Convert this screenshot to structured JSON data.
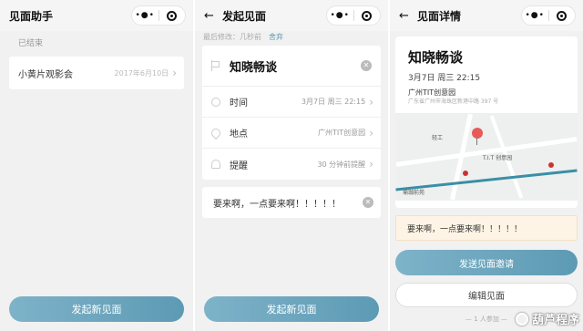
{
  "panel1": {
    "nav_title": "见面助手",
    "section_label": "已结束",
    "items": [
      {
        "title": "小黄片观影会",
        "date": "2017年6月10日"
      }
    ],
    "primary_button": "发起新见面"
  },
  "panel2": {
    "nav_title": "发起见面",
    "last_modified": "最后修改：几秒前",
    "discard": "舍弃",
    "event_title": "知晓畅谈",
    "fields": [
      {
        "label": "时间",
        "value": "3月7日   周三   22:15"
      },
      {
        "label": "地点",
        "value": "广州TIT创意园"
      },
      {
        "label": "提醒",
        "value": "30 分钟前提醒"
      }
    ],
    "note": "要来啊，一点要来啊！！！！！",
    "primary_button": "发起新见面"
  },
  "panel3": {
    "nav_title": "见面详情",
    "event_title": "知晓畅谈",
    "time": "3月7日   周三   22:15",
    "place": "广州TIT创意园",
    "address": "广东省广州市海珠区新港中路 397 号",
    "map_labels": {
      "poi": "T.I.T 创意园",
      "north": "轻工",
      "south": "瑜珈前苑"
    },
    "note": "要来啊，一点要来啊！！！！！",
    "send_button": "发送见面邀请",
    "edit_button": "编辑见面",
    "joined": "— 1 人参加 —"
  },
  "watermark": "葫芦程序",
  "icons": {
    "capsule_more": "more-dots-icon",
    "capsule_close": "target-circle-icon",
    "back": "back-arrow-icon"
  },
  "colors": {
    "accent": "#5d9ab4",
    "note_bg": "#fdf4e5"
  }
}
